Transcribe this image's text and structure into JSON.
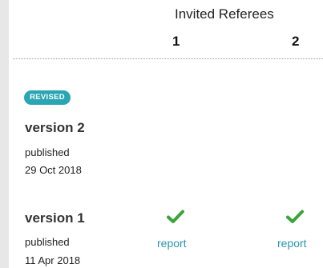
{
  "header": {
    "title": "Invited Referees",
    "referees": [
      "1",
      "2"
    ]
  },
  "badge": {
    "label": "REVISED",
    "color": "#2aa6b3"
  },
  "versions": [
    {
      "title": "version 2",
      "status": "published",
      "date": "29 Oct 2018"
    },
    {
      "title": "version 1",
      "status": "published",
      "date": "11 Apr 2018"
    }
  ],
  "reports": [
    {
      "icon": "checkmark-icon",
      "label": "report",
      "status_color": "#3aa43a"
    },
    {
      "icon": "checkmark-icon",
      "label": "report",
      "status_color": "#3aa43a"
    }
  ],
  "colors": {
    "accent": "#2aa6b3",
    "link": "#2a95ad",
    "approved": "#3aa43a"
  }
}
